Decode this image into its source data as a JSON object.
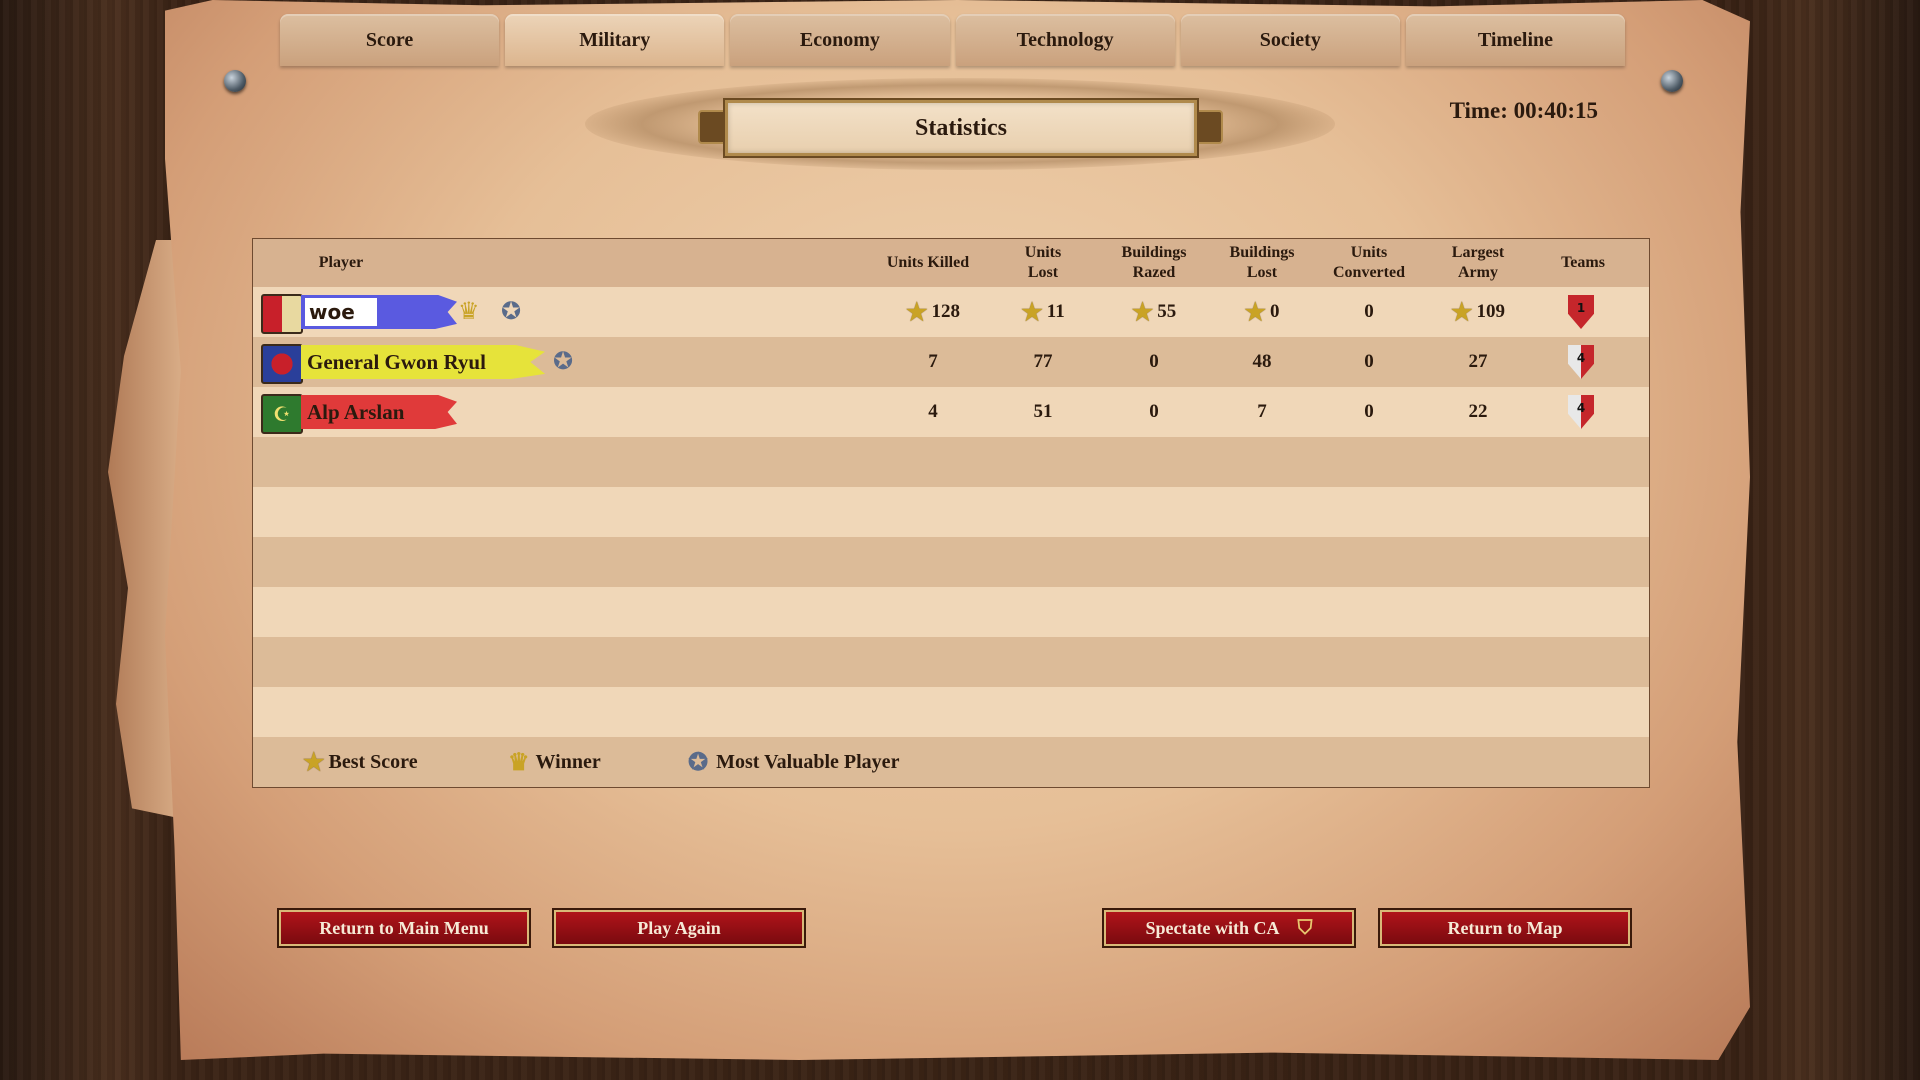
{
  "tabs": [
    "Score",
    "Military",
    "Economy",
    "Technology",
    "Society",
    "Timeline"
  ],
  "active_tab": "Military",
  "title": "Statistics",
  "time_label": "Time: 00:40:15",
  "columns": [
    "Player",
    "Units Killed",
    "Units\nLost",
    "Buildings\nRazed",
    "Buildings\nLost",
    "Units\nConverted",
    "Largest\nArmy",
    "Teams"
  ],
  "players": [
    {
      "name": "woe",
      "banner_color": "#5a5ae0",
      "crest": "castile-crest-icon",
      "winner": true,
      "mvp": true,
      "team": "1",
      "team_color": "#c5262b",
      "units_killed": "128",
      "units_lost": "11",
      "buildings_razed": "55",
      "buildings_lost": "0",
      "units_converted": "0",
      "largest_army": "109",
      "best": [
        true,
        true,
        true,
        true,
        false,
        true
      ]
    },
    {
      "name": "General Gwon Ryul",
      "banner_color": "#e6e33a",
      "crest": "korean-crest-icon",
      "winner": false,
      "mvp": true,
      "team": "4",
      "team_color": "#e8e8e8",
      "units_killed": "7",
      "units_lost": "77",
      "buildings_razed": "0",
      "buildings_lost": "48",
      "units_converted": "0",
      "largest_army": "27",
      "best": [
        false,
        false,
        false,
        false,
        false,
        false
      ]
    },
    {
      "name": "Alp Arslan",
      "banner_color": "#e03a3a",
      "crest": "turkish-crest-icon",
      "winner": false,
      "mvp": false,
      "team": "4",
      "team_color": "#e8e8e8",
      "units_killed": "4",
      "units_lost": "51",
      "buildings_razed": "0",
      "buildings_lost": "7",
      "units_converted": "0",
      "largest_army": "22",
      "best": [
        false,
        false,
        false,
        false,
        false,
        false
      ]
    }
  ],
  "legend": {
    "best_score": "Best Score",
    "winner": "Winner",
    "mvp": "Most Valuable Player"
  },
  "buttons": {
    "main_menu": "Return to Main Menu",
    "play_again": "Play Again",
    "spectate": "Spectate with CA",
    "return_map": "Return to Map"
  },
  "colors": {
    "button_red": "#9a0f15",
    "star_gold": "#c9a325",
    "parchment": "#e6bf97"
  }
}
